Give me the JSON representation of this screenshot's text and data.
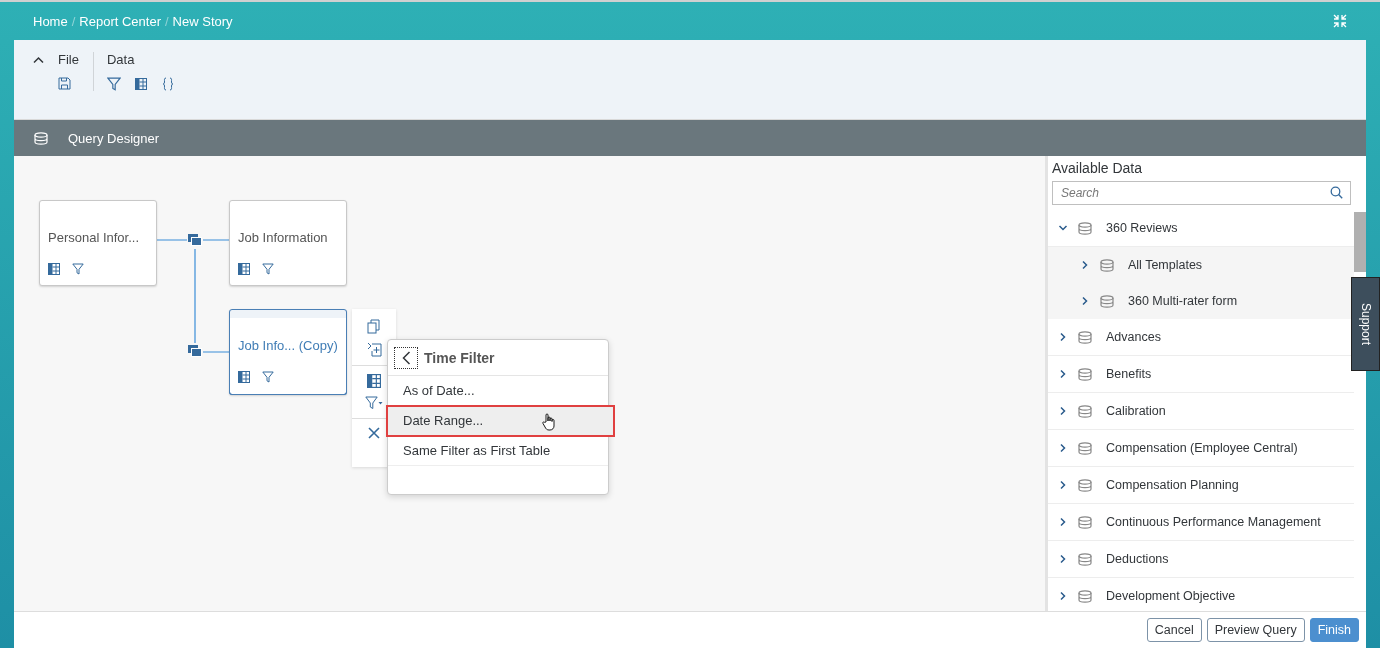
{
  "breadcrumb": {
    "items": [
      "Home",
      "Report Center",
      "New Story"
    ],
    "separator": "/"
  },
  "toolbar": {
    "groups": [
      {
        "label": "File",
        "kind": "file"
      },
      {
        "label": "Data",
        "kind": "data"
      }
    ]
  },
  "section_title": "Query Designer",
  "nodes": [
    {
      "name": "Personal Infor...",
      "selected": false
    },
    {
      "name": "Job Information",
      "selected": false
    },
    {
      "name": "Job Info... (Copy)",
      "selected": true
    }
  ],
  "time_filter_menu": {
    "title": "Time Filter",
    "items": [
      {
        "label": "As of Date...",
        "highlighted": false
      },
      {
        "label": "Date Range...",
        "highlighted": true
      },
      {
        "label": "Same Filter as First Table",
        "highlighted": false
      }
    ]
  },
  "available_data": {
    "title": "Available Data",
    "search": {
      "placeholder": "Search"
    },
    "items": [
      {
        "label": "360 Reviews",
        "expanded": true,
        "children": [
          {
            "label": "All Templates",
            "expanded": false
          },
          {
            "label": "360 Multi-rater form",
            "expanded": false
          }
        ]
      },
      {
        "label": "Advances",
        "expanded": false
      },
      {
        "label": "Benefits",
        "expanded": false
      },
      {
        "label": "Calibration",
        "expanded": false
      },
      {
        "label": "Compensation (Employee Central)",
        "expanded": false
      },
      {
        "label": "Compensation Planning",
        "expanded": false
      },
      {
        "label": "Continuous Performance Management",
        "expanded": false
      },
      {
        "label": "Deductions",
        "expanded": false
      },
      {
        "label": "Development Objective",
        "expanded": false
      }
    ]
  },
  "support_tab": "Support",
  "buttons": [
    {
      "label": "Cancel",
      "kind": "secondary"
    },
    {
      "label": "Preview Query",
      "kind": "secondary"
    },
    {
      "label": "Finish",
      "kind": "primary"
    }
  ]
}
